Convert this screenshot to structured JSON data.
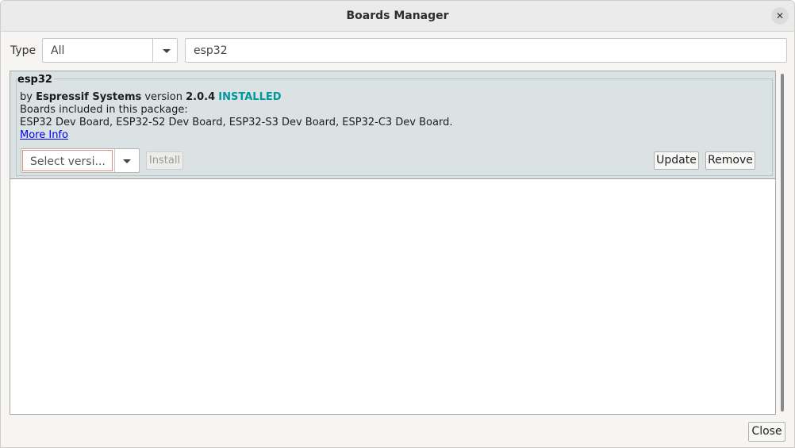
{
  "window": {
    "title": "Boards Manager",
    "close_icon": "close-icon"
  },
  "filter": {
    "type_label": "Type",
    "type_value": "All",
    "search_value": "esp32"
  },
  "package": {
    "name": "esp32",
    "by_prefix": "by ",
    "author": "Espressif Systems",
    "version_prefix": " version ",
    "version": "2.0.4",
    "status": "INSTALLED",
    "boards_heading": "Boards included in this package:",
    "boards_list": "ESP32 Dev Board, ESP32-S2 Dev Board, ESP32-S3 Dev Board, ESP32-C3 Dev Board.",
    "more_info": "More Info",
    "select_version": "Select versi...",
    "install_label": "Install",
    "update_label": "Update",
    "remove_label": "Remove"
  },
  "footer": {
    "close_label": "Close"
  },
  "colors": {
    "installed": "#00979d",
    "card_bg": "#dae2e3",
    "link": "#0000ee"
  }
}
